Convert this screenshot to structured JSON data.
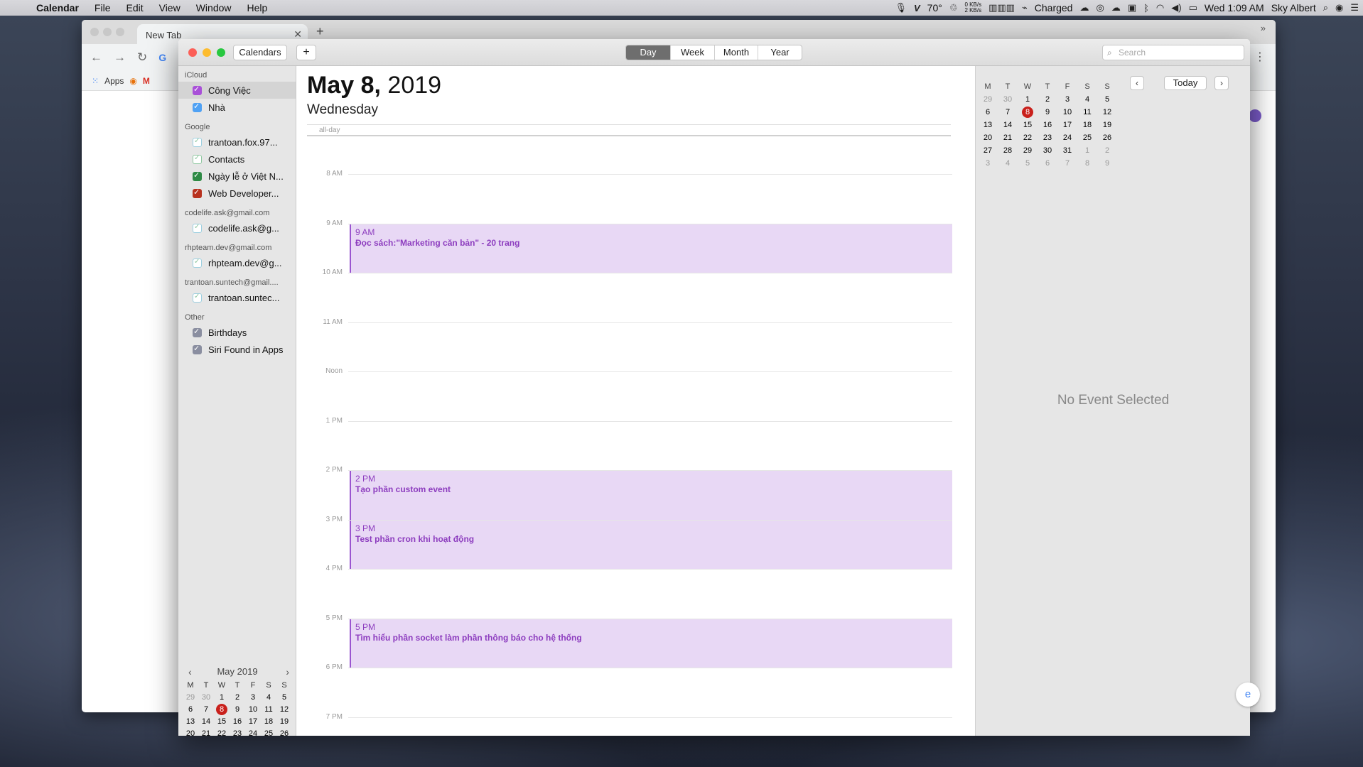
{
  "menubar": {
    "app": "Calendar",
    "menus": [
      "File",
      "Edit",
      "View",
      "Window",
      "Help"
    ],
    "temp": "70°",
    "net_up": "0 KB/s",
    "net_down": "2 KB/s",
    "battery": "Charged",
    "clock": "Wed 1:09 AM",
    "user": "Sky Albert"
  },
  "chrome": {
    "tab_title": "New Tab",
    "bookmark_apps": "Apps"
  },
  "calendar": {
    "toolbar": {
      "calendars_label": "Calendars",
      "add_label": "+",
      "views": [
        "Day",
        "Week",
        "Month",
        "Year"
      ],
      "active_view": "Day",
      "search_placeholder": "Search"
    },
    "sidebar": {
      "groups": [
        {
          "header": "iCloud",
          "items": [
            {
              "label": "Công Việc",
              "color": "#a950d8",
              "selected": true
            },
            {
              "label": "Nhà",
              "color": "#4fa1f4"
            }
          ]
        },
        {
          "header": "Google",
          "items": [
            {
              "label": "trantoan.fox.97...",
              "color": "#9ccfe0",
              "style": "outline"
            },
            {
              "label": "Contacts",
              "color": "#8fc7a0",
              "style": "outline"
            },
            {
              "label": "Ngày lễ ở Việt N...",
              "color": "#2e8a45"
            },
            {
              "label": "Web Developer...",
              "color": "#b8321f"
            }
          ]
        },
        {
          "header": "codelife.ask@gmail.com",
          "items": [
            {
              "label": "codelife.ask@g...",
              "color": "#9ccfe0",
              "style": "outline"
            }
          ]
        },
        {
          "header": "rhpteam.dev@gmail.com",
          "items": [
            {
              "label": "rhpteam.dev@g...",
              "color": "#9ccfe0",
              "style": "outline"
            }
          ]
        },
        {
          "header": "trantoan.suntech@gmail....",
          "items": [
            {
              "label": "trantoan.suntec...",
              "color": "#9ccfe0",
              "style": "outline"
            }
          ]
        },
        {
          "header": "Other",
          "items": [
            {
              "label": "Birthdays",
              "color": "#8a8ea0"
            },
            {
              "label": "Siri Found in Apps",
              "color": "#8a8ea0"
            }
          ]
        }
      ],
      "mini_month": "May 2019"
    },
    "day": {
      "date_bold": "May 8,",
      "year": "2019",
      "weekday": "Wednesday",
      "allday_label": "all-day",
      "hours": [
        "8 AM",
        "9 AM",
        "10 AM",
        "11 AM",
        "Noon",
        "1 PM",
        "2 PM",
        "3 PM",
        "4 PM",
        "5 PM",
        "6 PM",
        "7 PM"
      ],
      "events": [
        {
          "time": "9 AM",
          "title": "Đọc sách:\"Marketing căn bản\" - 20 trang",
          "start": 9,
          "end": 10
        },
        {
          "time": "2 PM",
          "title": "Tạo phần custom event",
          "start": 14,
          "end": 15
        },
        {
          "time": "3 PM",
          "title": "Test phần cron khi hoạt động",
          "start": 15,
          "end": 16
        },
        {
          "time": "5 PM",
          "title": "Tìm hiểu phần socket làm phần thông báo cho hệ thống",
          "start": 17,
          "end": 18
        }
      ]
    },
    "month_grid": {
      "day_headers": [
        "M",
        "T",
        "W",
        "T",
        "F",
        "S",
        "S"
      ],
      "weeks": [
        [
          "29",
          "30",
          "1",
          "2",
          "3",
          "4",
          "5"
        ],
        [
          "6",
          "7",
          "8",
          "9",
          "10",
          "11",
          "12"
        ],
        [
          "13",
          "14",
          "15",
          "16",
          "17",
          "18",
          "19"
        ],
        [
          "20",
          "21",
          "22",
          "23",
          "24",
          "25",
          "26"
        ],
        [
          "27",
          "28",
          "29",
          "30",
          "31",
          "1",
          "2"
        ],
        [
          "3",
          "4",
          "5",
          "6",
          "7",
          "8",
          "9"
        ]
      ],
      "today": "8"
    },
    "inspector": {
      "today_label": "Today",
      "empty_text": "No Event Selected"
    }
  }
}
